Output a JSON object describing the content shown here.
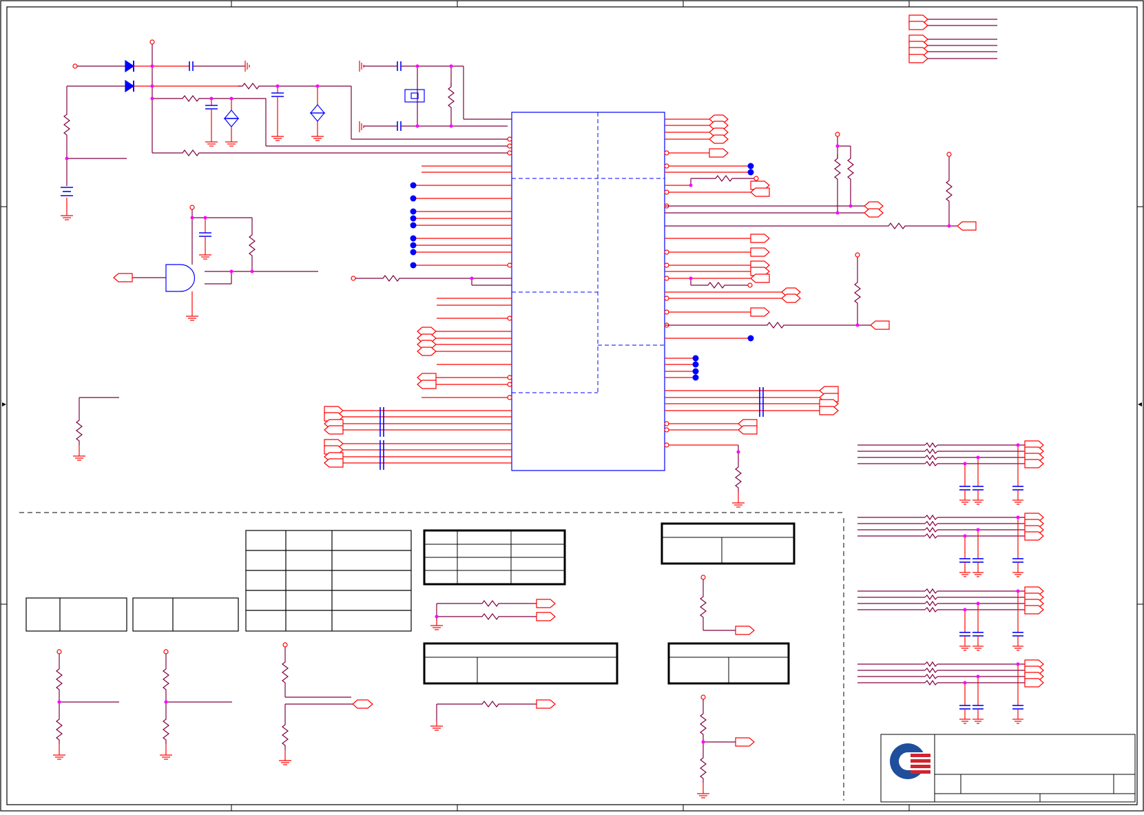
{
  "sheet": {
    "title": "",
    "logo": "quanta-logo"
  },
  "colors": {
    "wire": "#ff0000",
    "net_wire": "#800040",
    "component": "#0000ff",
    "junction": "#ff00ff",
    "no_connect": "#0000ff",
    "border": "#000000",
    "logo_blue": "#1f4e9c",
    "logo_red": "#d1242f"
  },
  "tables": {
    "table_a": {
      "rows": 2,
      "cols": 2,
      "cells": []
    },
    "table_b": {
      "rows": 2,
      "cols": 2,
      "cells": []
    },
    "table_c": {
      "rows": 5,
      "cols": 3,
      "cells": []
    },
    "table_d": {
      "rows": 4,
      "cols": 3,
      "cells": []
    },
    "table_e": {
      "rows": 2,
      "cols": 2,
      "cells": []
    },
    "table_f": {
      "rows": 2,
      "cols": 2,
      "cells": []
    },
    "table_g": {
      "rows": 2,
      "cols": 2,
      "cells": []
    }
  }
}
